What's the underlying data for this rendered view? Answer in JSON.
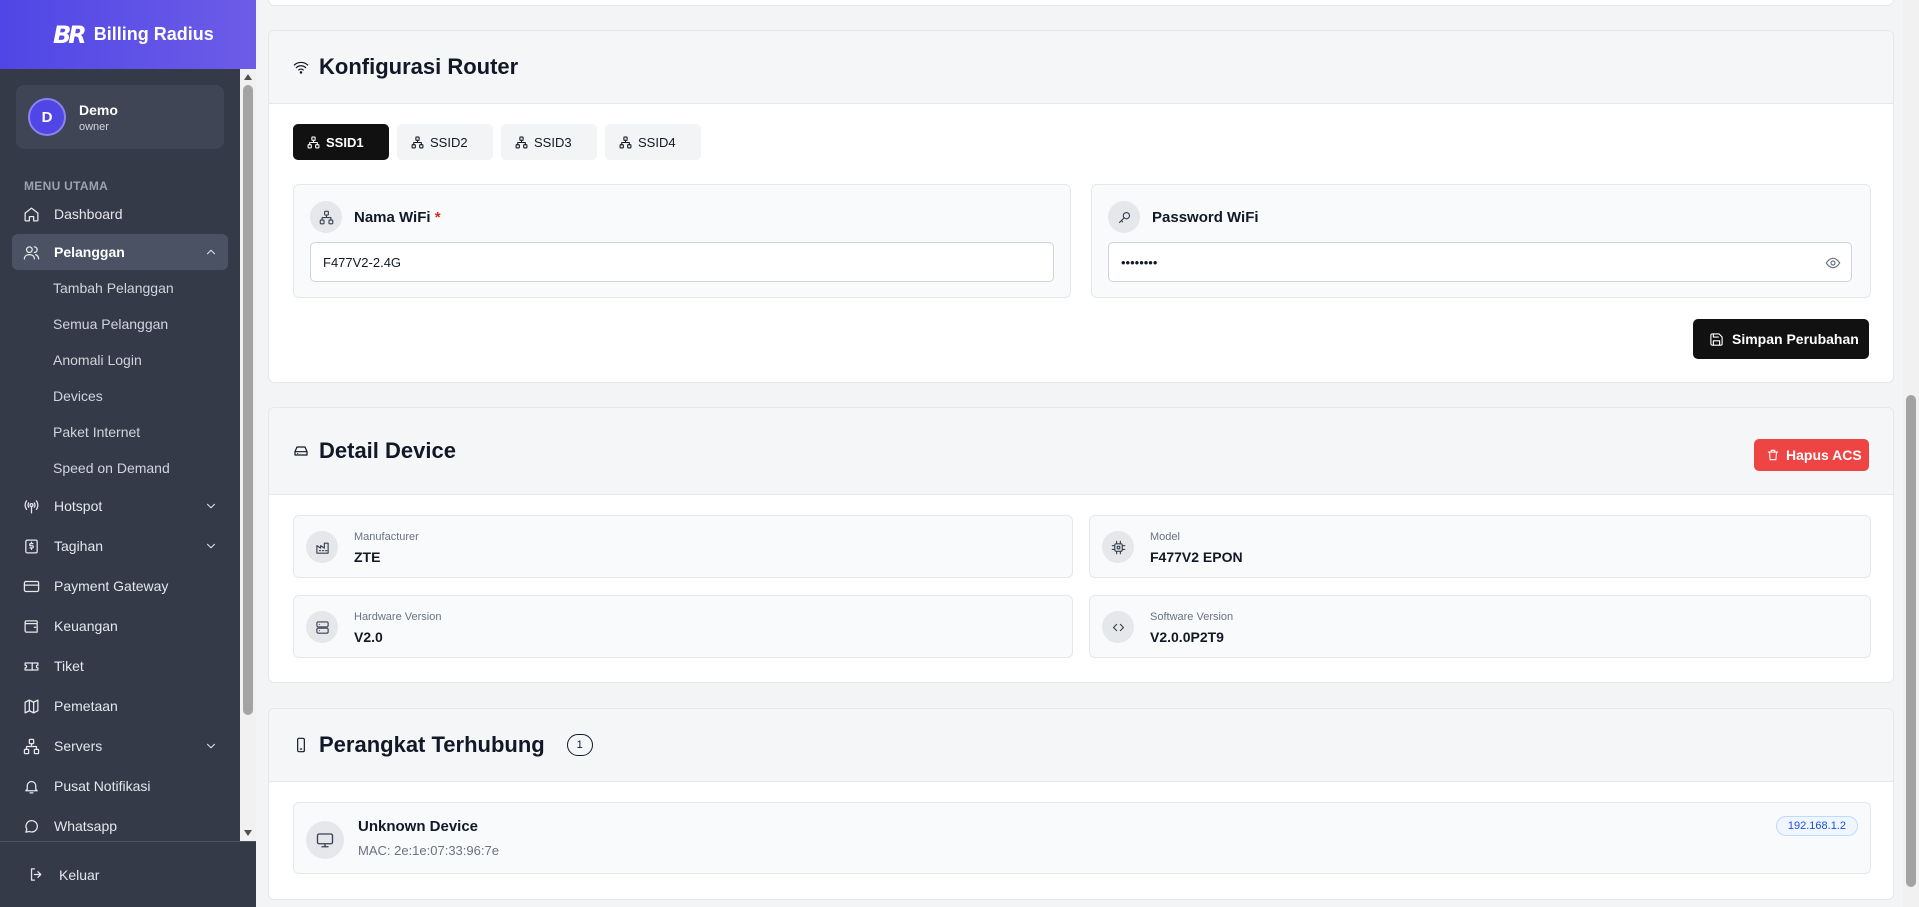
{
  "sidebar": {
    "brand_logo": "BR",
    "brand_name": "Billing Radius",
    "user": {
      "initial": "D",
      "name": "Demo",
      "role": "owner"
    },
    "menu_title": "MENU UTAMA",
    "items": {
      "dashboard": "Dashboard",
      "pelanggan": "Pelanggan",
      "hotspot": "Hotspot",
      "tagihan": "Tagihan",
      "payment_gateway": "Payment Gateway",
      "keuangan": "Keuangan",
      "tiket": "Tiket",
      "pemetaan": "Pemetaan",
      "servers": "Servers",
      "pusat_notifikasi": "Pusat Notifikasi",
      "whatsapp": "Whatsapp"
    },
    "pelanggan_sub": [
      "Tambah Pelanggan",
      "Semua Pelanggan",
      "Anomali Login",
      "Devices",
      "Paket Internet",
      "Speed on Demand"
    ],
    "logout": "Keluar"
  },
  "router": {
    "title": "Konfigurasi Router",
    "tabs": [
      "SSID1",
      "SSID2",
      "SSID3",
      "SSID4"
    ],
    "active_tab": "SSID1",
    "wifi_name_label": "Nama WiFi",
    "required_mark": "*",
    "wifi_name_value": "F477V2-2.4G",
    "password_label": "Password WiFi",
    "password_value": "••••••••",
    "save_label": "Simpan Perubahan"
  },
  "device": {
    "title": "Detail Device",
    "delete_label": "Hapus ACS",
    "manufacturer_label": "Manufacturer",
    "manufacturer_value": "ZTE",
    "model_label": "Model",
    "model_value": "F477V2 EPON",
    "hw_label": "Hardware Version",
    "hw_value": "V2.0",
    "sw_label": "Software Version",
    "sw_value": "V2.0.0P2T9"
  },
  "connected": {
    "title": "Perangkat Terhubung",
    "count": "1",
    "devices": [
      {
        "name": "Unknown Device",
        "mac": "MAC: 2e:1e:07:33:96:7e",
        "ip": "192.168.1.2"
      }
    ]
  },
  "colors": {
    "brand": "#4f46e5",
    "sidebar": "#343a48",
    "danger": "#ef4444",
    "primary_button": "#111111",
    "ip_badge": "#1d4ed8"
  }
}
